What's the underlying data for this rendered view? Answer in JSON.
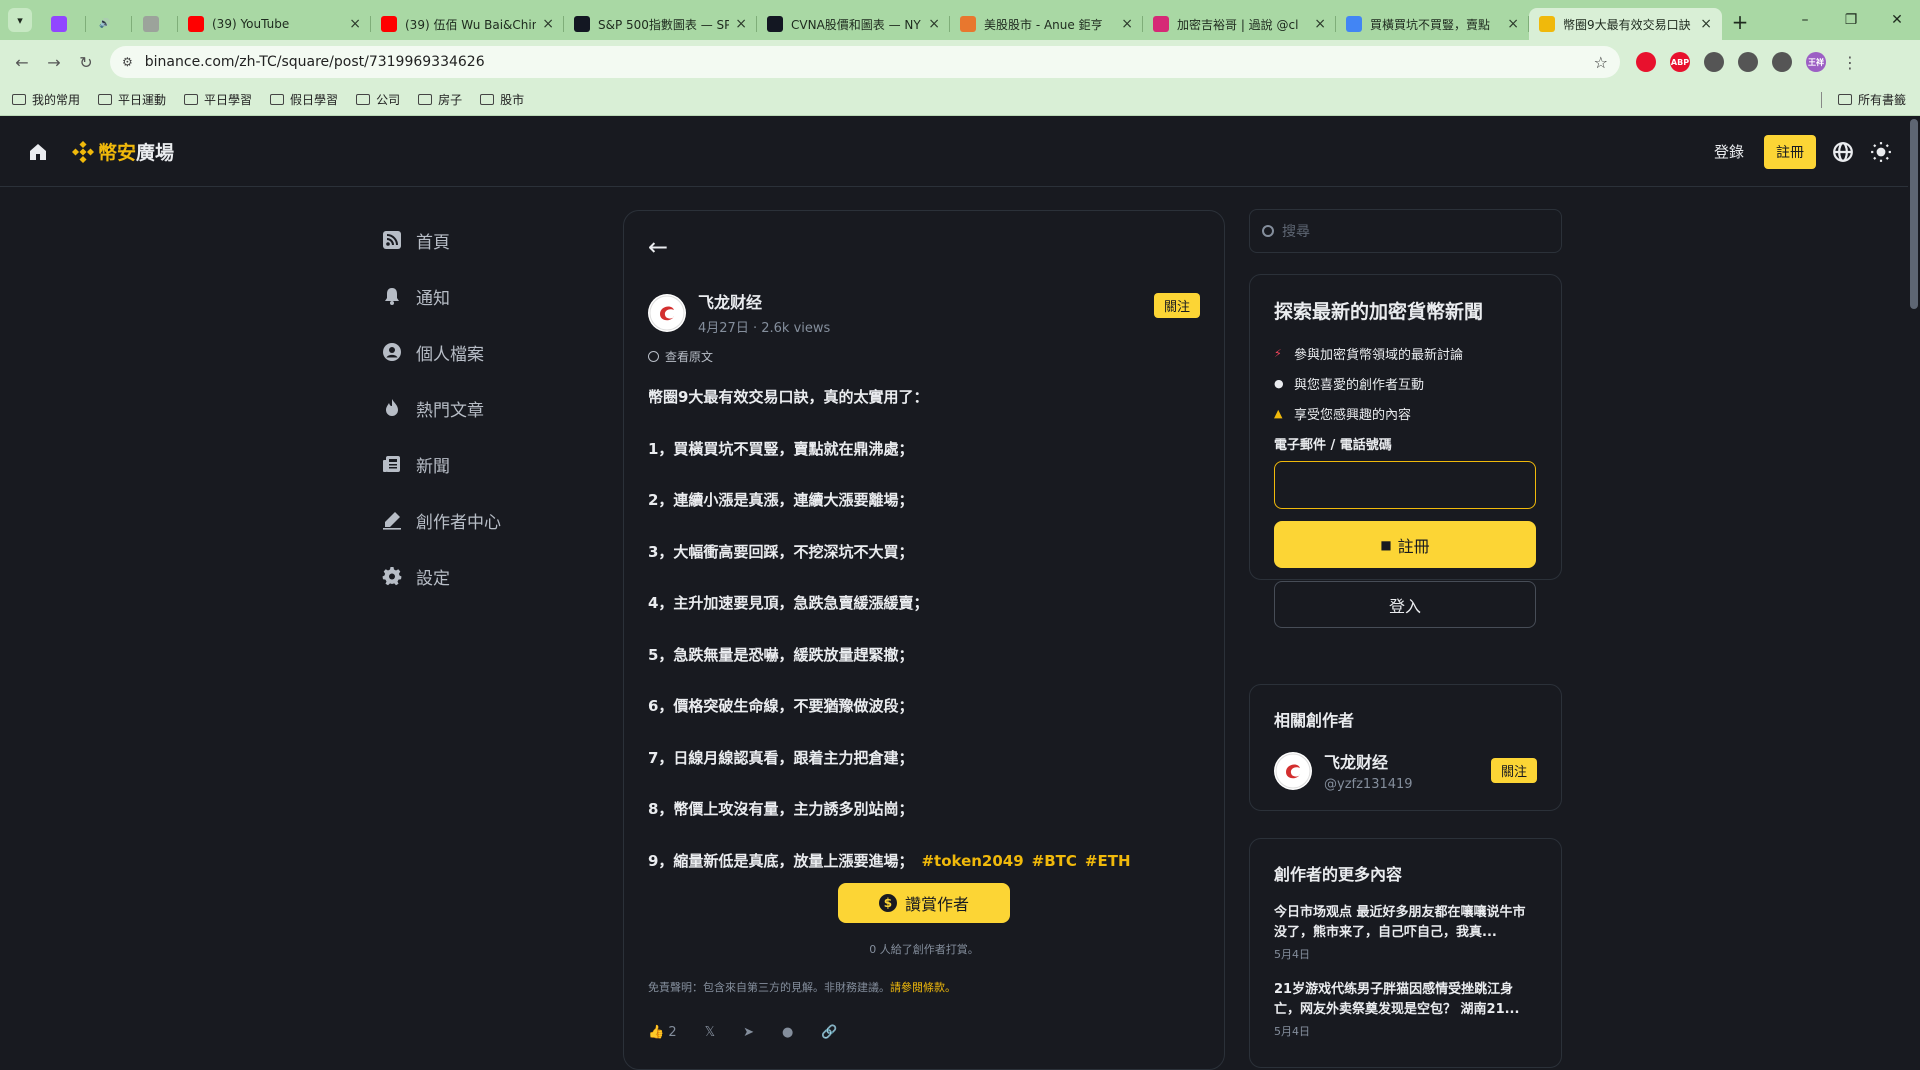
{
  "browser": {
    "tabs": [
      {
        "title": "",
        "favicon_color": "#9146ff",
        "pinned": true
      },
      {
        "title": "",
        "favicon_color": "#444444",
        "pinned": true,
        "icon": "speaker-icon"
      },
      {
        "title": "",
        "favicon_color": "#9ca39b",
        "pinned": true
      },
      {
        "title": "(39) YouTube",
        "favicon_color": "#ff0000"
      },
      {
        "title": "(39) 伍佰 Wu Bai&Chin",
        "favicon_color": "#ff0000"
      },
      {
        "title": "S&P 500指數圖表 — SP",
        "favicon_color": "#131722"
      },
      {
        "title": "CVNA股價和圖表 — NY",
        "favicon_color": "#131722"
      },
      {
        "title": "美股股市 - Anue 鉅亨",
        "favicon_color": "#e8772e"
      },
      {
        "title": "加密吉裕哥 | 過說 @cl",
        "favicon_color": "#d62976"
      },
      {
        "title": "買橫買坑不買豎，賣點",
        "favicon_color": "#4285f4"
      },
      {
        "title": "幣圈9大最有效交易口訣",
        "favicon_color": "#f0b90b",
        "active": true
      }
    ],
    "window_controls": {
      "minimize": "–",
      "restore": "❐",
      "close": "✕"
    },
    "url": "binance.com/zh-TC/square/post/7319969334626",
    "extensions": [
      {
        "name": "opera-icon",
        "color": "#e8112d",
        "text": ""
      },
      {
        "name": "adblock-icon",
        "color": "#e8112d",
        "text": "ABP"
      },
      {
        "name": "qr-icon",
        "color": "#555555",
        "text": ""
      },
      {
        "name": "puzzle-icon",
        "color": "#555555",
        "text": ""
      },
      {
        "name": "media-icon",
        "color": "#555555",
        "text": ""
      },
      {
        "name": "profile-avatar",
        "color": "#9c5fc4",
        "text": "王祥"
      }
    ],
    "bookmarks": [
      "我的常用",
      "平日運動",
      "平日學習",
      "假日學習",
      "公司",
      "房子",
      "股市"
    ],
    "bookmarks_right": "所有書籤"
  },
  "header": {
    "brand": "幣安",
    "plaza": "廣場",
    "login": "登錄",
    "register": "註冊"
  },
  "nav": [
    {
      "label": "首頁",
      "icon": "rss-icon"
    },
    {
      "label": "通知",
      "icon": "bell-icon"
    },
    {
      "label": "個人檔案",
      "icon": "user-icon"
    },
    {
      "label": "熱門文章",
      "icon": "fire-icon"
    },
    {
      "label": "新聞",
      "icon": "news-icon"
    },
    {
      "label": "創作者中心",
      "icon": "pen-icon"
    },
    {
      "label": "設定",
      "icon": "gear-icon"
    }
  ],
  "post": {
    "author": "飞龙财经",
    "date": "4月27日",
    "views": "2.6k views",
    "follow": "關注",
    "view_original": "查看原文",
    "lines": [
      "幣圈9大最有效交易口訣，真的太實用了：",
      "1，買橫買坑不買豎，賣點就在鼎沸處；",
      "2，連續小漲是真漲，連續大漲要離場；",
      "3，大幅衝高要回踩，不挖深坑不大買；",
      "4，主升加速要見頂，急跌急賣緩漲緩賣；",
      "5，急跌無量是恐嚇，緩跌放量趕緊撤；",
      "6，價格突破生命線，不要猶豫做波段；",
      "7，日線月線認真看，跟着主力把倉建；",
      "8，幣價上攻沒有量，主力誘多別站崗；"
    ],
    "last_line": "9，縮量新低是真底，放量上漲要進場；",
    "tags": [
      "#token2049",
      "#BTC",
      "#ETH"
    ],
    "tip_button": "讚賞作者",
    "tip_count": "0 人給了創作者打賞。",
    "disclaimer": "免責聲明：包含來自第三方的見解。非財務建議。",
    "disclaimer_link": "請參閱條款。",
    "likes": "2"
  },
  "sidebar": {
    "search_placeholder": "搜尋",
    "signup_card": {
      "title": "探索最新的加密貨幣新聞",
      "bullets": [
        "參與加密貨幣領域的最新討論",
        "與您喜愛的創作者互動",
        "享受您感興趣的內容"
      ],
      "field_label": "電子郵件 / 電話號碼",
      "signup": "註冊",
      "login": "登入"
    },
    "related": {
      "title": "相關創作者",
      "name": "飞龙财经",
      "handle": "@yzfz131419",
      "follow": "關注"
    },
    "more": {
      "title": "創作者的更多內容",
      "items": [
        {
          "title": "今日市场观点 最近好多朋友都在嚷嚷说牛市没了，熊市来了，自己吓自己，我真...",
          "date": "5月4日"
        },
        {
          "title": "21岁游戏代练男子胖猫因感情受挫跳江身亡，网友外卖祭奠发现是空包？ 湖南21...",
          "date": "5月4日"
        }
      ]
    }
  }
}
